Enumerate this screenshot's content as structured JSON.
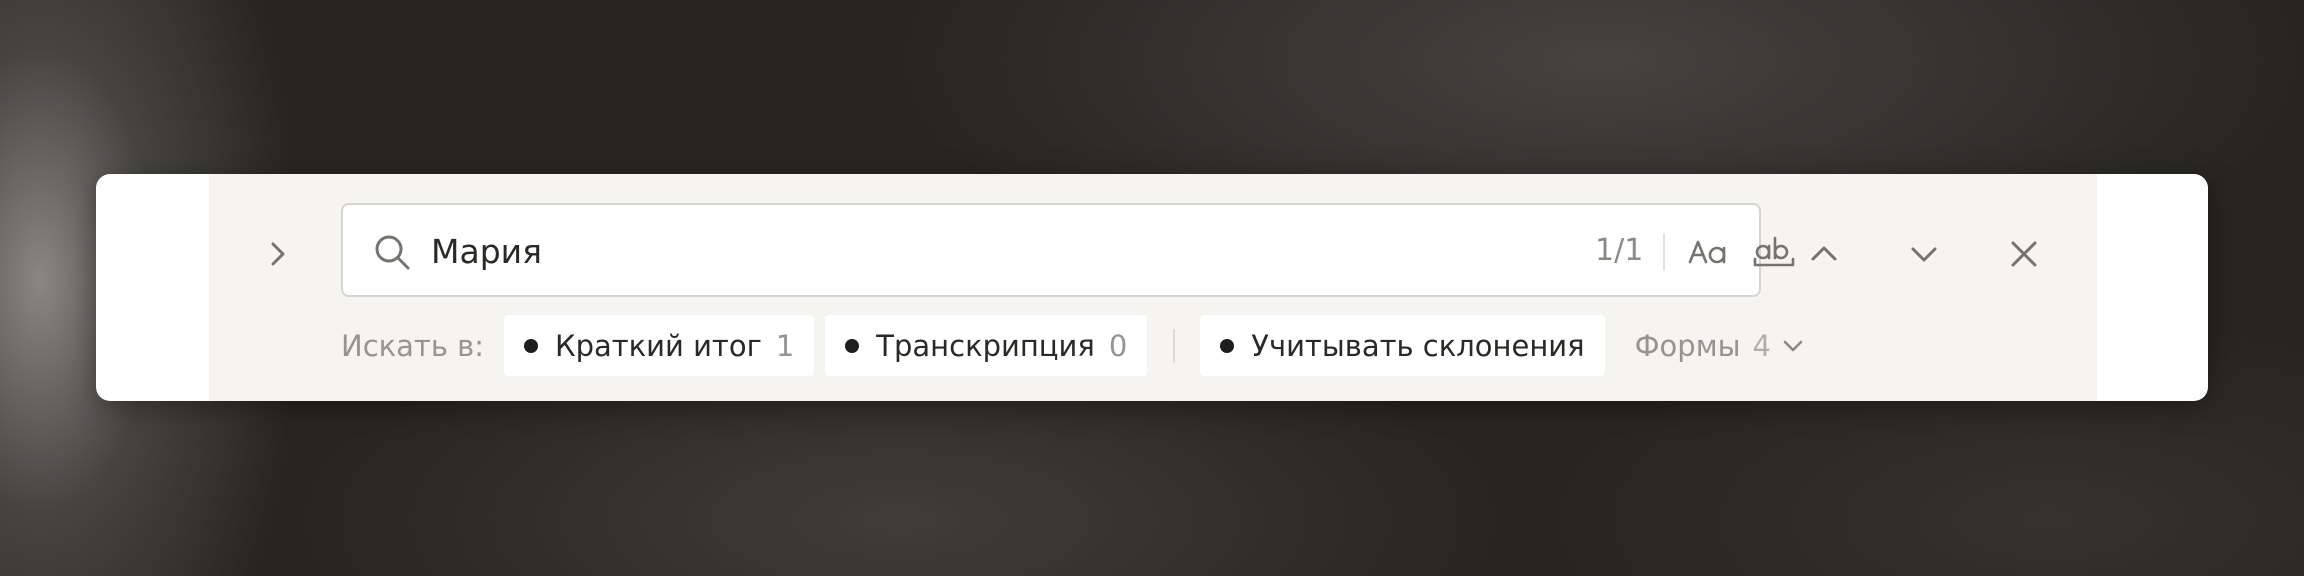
{
  "search": {
    "query": "Мария",
    "match_counter": "1/1",
    "icons": {
      "search": "search-icon",
      "match_case": "match-case-icon",
      "whole_word": "whole-word-icon"
    }
  },
  "toolbar": {
    "icons": {
      "expand": "chevron-right-icon",
      "prev": "chevron-up-icon",
      "next": "chevron-down-icon",
      "close": "close-icon"
    }
  },
  "filters": {
    "search_in_label": "Искать в:",
    "scopes": [
      {
        "label": "Краткий итог",
        "count": "1"
      },
      {
        "label": "Транскрипция",
        "count": "0"
      }
    ],
    "declension_label": "Учитывать склонения",
    "forms_label": "Формы",
    "forms_count": "4"
  },
  "colors": {
    "panel": "#f5f4f1",
    "chip": "#ffffff",
    "text": "#2a2926",
    "muted": "#96948f",
    "icon": "#75736e"
  }
}
